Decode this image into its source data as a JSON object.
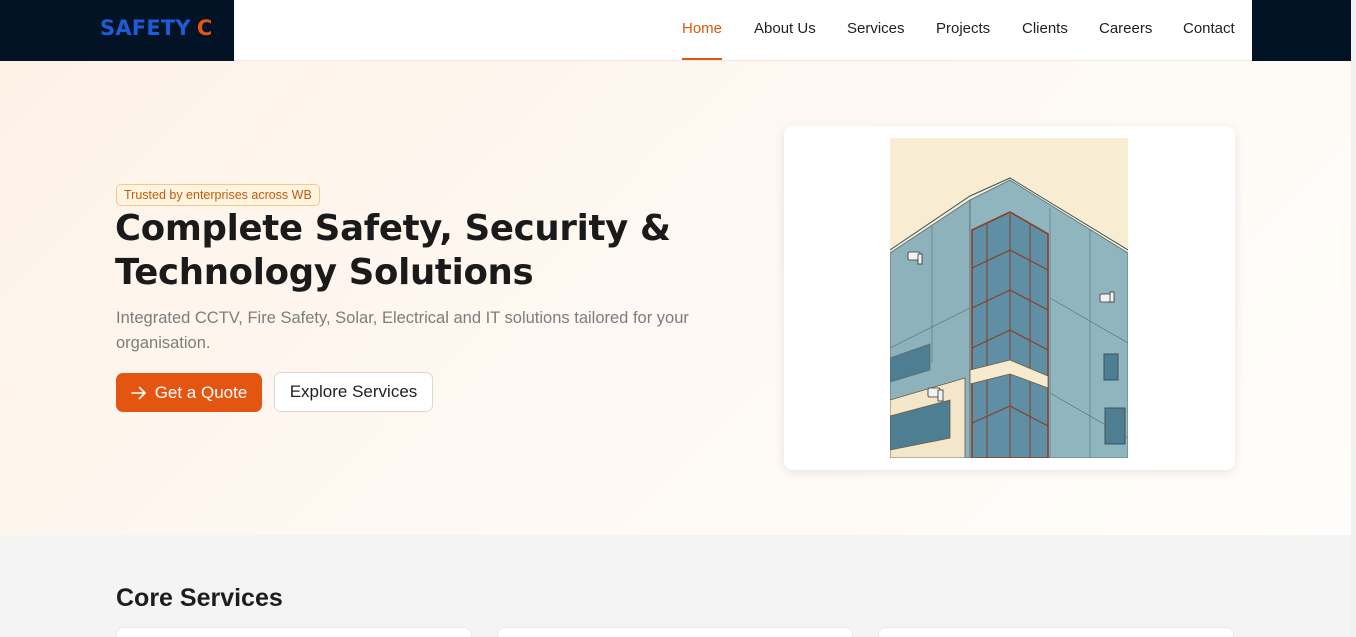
{
  "brand": {
    "name": "SAFETY",
    "accent": "C",
    "colors": {
      "name": "#1e5cd6",
      "accent": "#e65510",
      "background": "#021325"
    }
  },
  "nav": {
    "items": [
      {
        "label": "Home",
        "active": true
      },
      {
        "label": "About Us",
        "active": false
      },
      {
        "label": "Services",
        "active": false
      },
      {
        "label": "Projects",
        "active": false
      },
      {
        "label": "Clients",
        "active": false
      },
      {
        "label": "Careers",
        "active": false
      },
      {
        "label": "Contact",
        "active": false
      }
    ],
    "accent_color": "#e0560f"
  },
  "hero": {
    "badge": "Trusted by enterprises across WB",
    "title_line1": "Complete Safety, Security &",
    "title_line2": "Technology Solutions",
    "subtitle": "Integrated CCTV, Fire Safety, Solar, Electrical and IT solutions tailored for your organisation.",
    "primary_button": {
      "label": "Get a Quote",
      "icon": "arrow-right-icon"
    },
    "secondary_button": {
      "label": "Explore Services"
    },
    "image_icon": "building-with-cctv-illustration"
  },
  "services": {
    "title": "Core Services",
    "cards_visible": 3
  }
}
